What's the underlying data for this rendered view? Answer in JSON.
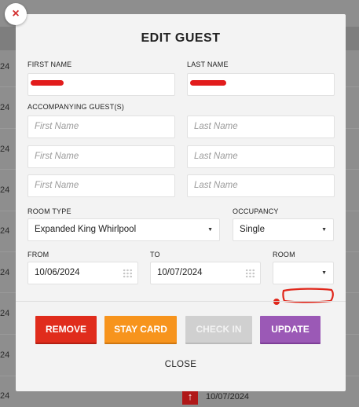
{
  "background": {
    "row_date_fragment": "24",
    "bottom_row_date": "10/07/2024"
  },
  "modal": {
    "title": "EDIT GUEST",
    "close_icon_glyph": "×",
    "first_name_label": "FIRST NAME",
    "last_name_label": "LAST NAME",
    "accompanying_label": "ACCOMPANYING GUEST(S)",
    "first_name_placeholder": "First Name",
    "last_name_placeholder": "Last Name",
    "room_type_label": "ROOM TYPE",
    "room_type_value": "Expanded King Whirlpool",
    "occupancy_label": "OCCUPANCY",
    "occupancy_value": "Single",
    "from_label": "FROM",
    "from_value": "10/06/2024",
    "to_label": "TO",
    "to_value": "10/07/2024",
    "room_label": "ROOM",
    "room_value": "",
    "dropdown_glyph": "▼",
    "buttons": {
      "remove": "REMOVE",
      "stay_card": "STAY CARD",
      "check_in": "CHECK IN",
      "update": "UPDATE"
    },
    "close_label": "CLOSE"
  },
  "icons": {
    "close": "close-icon",
    "dropdown": "chevron-down-icon",
    "calendar": "calendar-icon",
    "up_arrow": "arrow-up-icon"
  },
  "colors": {
    "remove": "#e02c1c",
    "stay_card": "#f7941d",
    "check_in": "#d0d0d0",
    "update": "#9b59b6",
    "redaction": "#e21c1c"
  }
}
